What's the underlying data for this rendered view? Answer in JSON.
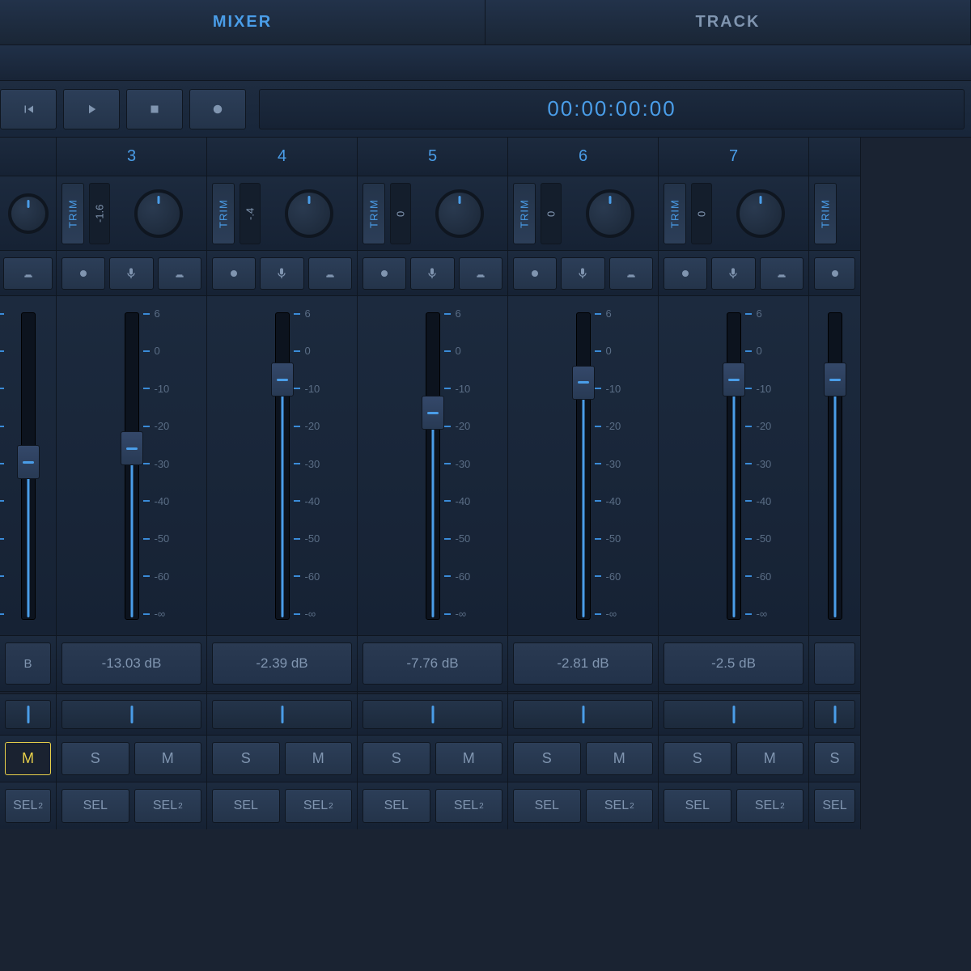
{
  "tabs": {
    "mixer": "MIXER",
    "track": "TRACK"
  },
  "timecode": "00:00:00:00",
  "scale": [
    "6",
    "0",
    "-10",
    "-20",
    "-30",
    "-40",
    "-50",
    "-60",
    "-∞"
  ],
  "trim_label": "TRIM",
  "sm": {
    "s": "S",
    "m": "M"
  },
  "sel": {
    "sel": "SEL",
    "sel2": "SEL",
    "sup": "2"
  },
  "channels": [
    {
      "num": "",
      "trim": "",
      "db": "B",
      "fader_pct": 48,
      "fill_pct": 50,
      "m_active": true,
      "pan": 50,
      "first": true
    },
    {
      "num": "3",
      "trim": "-1.6",
      "db": "-13.03 dB",
      "fader_pct": 43,
      "fill_pct": 55,
      "m_active": false,
      "pan": 50
    },
    {
      "num": "4",
      "trim": "-.4",
      "db": "-2.39 dB",
      "fader_pct": 18,
      "fill_pct": 80,
      "m_active": false,
      "pan": 50
    },
    {
      "num": "5",
      "trim": "0",
      "db": "-7.76 dB",
      "fader_pct": 30,
      "fill_pct": 68,
      "m_active": false,
      "pan": 50
    },
    {
      "num": "6",
      "trim": "0",
      "db": "-2.81 dB",
      "fader_pct": 19,
      "fill_pct": 79,
      "m_active": false,
      "pan": 50
    },
    {
      "num": "7",
      "trim": "0",
      "db": "-2.5 dB",
      "fader_pct": 18,
      "fill_pct": 80,
      "m_active": false,
      "pan": 50
    },
    {
      "num": "",
      "trim": "",
      "db": "",
      "fader_pct": 18,
      "fill_pct": 80,
      "m_active": false,
      "pan": 50,
      "last": true
    }
  ]
}
